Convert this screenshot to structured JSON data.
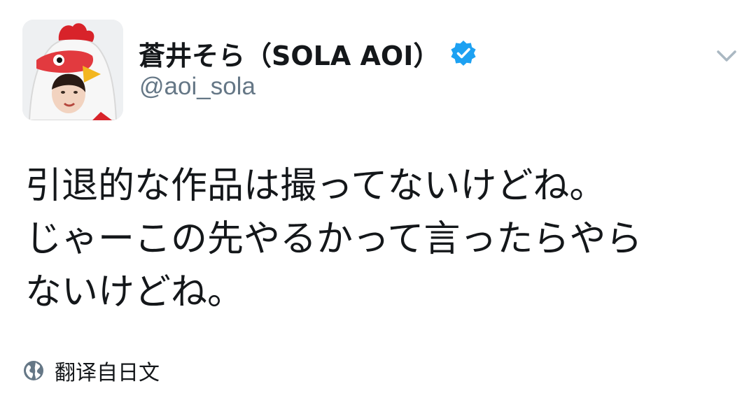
{
  "user": {
    "display_name": "蒼井そら（SOLA AOI）",
    "handle": "@aoi_sola",
    "verified": true,
    "avatar_icon": "avatar-chicken-costume"
  },
  "tweet": {
    "lines": [
      "引退的な作品は撮ってないけどね。",
      "じゃーこの先やるかって言ったらやら",
      "ないけどね。"
    ]
  },
  "actions": {
    "translate_label": "翻译自日文",
    "menu_icon": "chevron-down-icon"
  },
  "colors": {
    "verified_blue": "#1da1f2",
    "handle_gray": "#657786",
    "text": "#14171a",
    "icon_gray": "#aab8c2"
  }
}
